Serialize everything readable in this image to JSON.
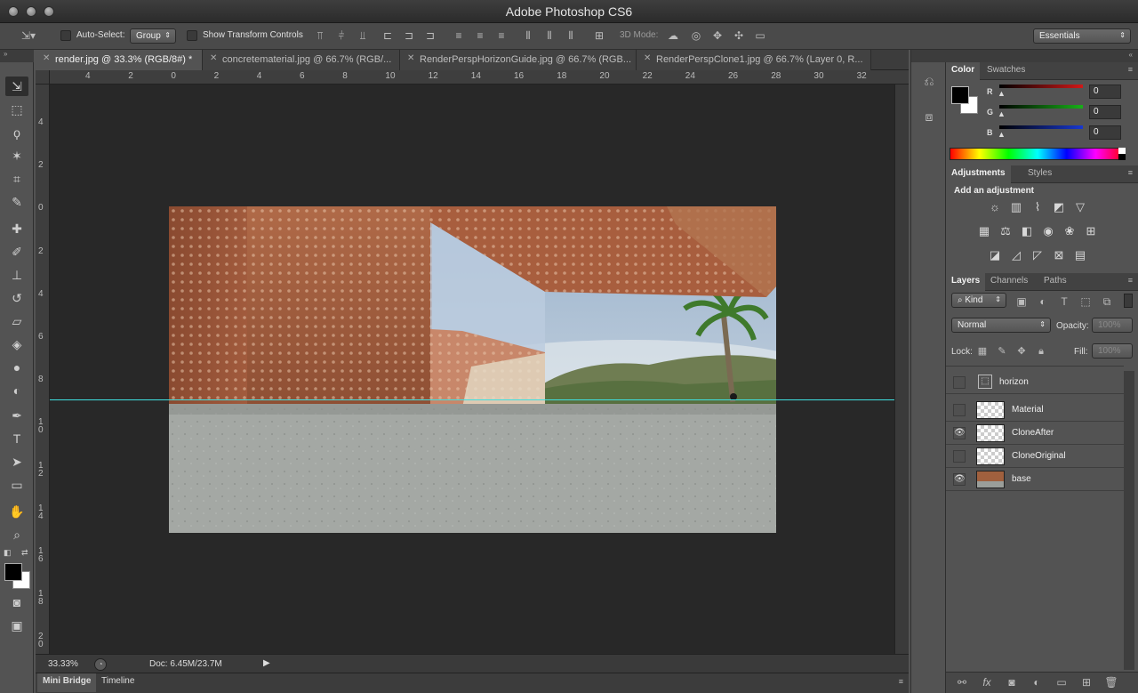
{
  "app": {
    "title": "Adobe Photoshop CS6"
  },
  "options": {
    "auto_select_label": "Auto-Select:",
    "auto_select_value": "Group",
    "transform_label": "Show Transform Controls",
    "mode_label": "3D Mode:",
    "workspace": "Essentials"
  },
  "tabs": [
    {
      "label": "render.jpg @ 33.3% (RGB/8#) *"
    },
    {
      "label": "concretematerial.jpg @ 66.7% (RGB/..."
    },
    {
      "label": "RenderPerspHorizonGuide.jpg @ 66.7% (RGB..."
    },
    {
      "label": "RenderPerspClone1.jpg @ 66.7% (Layer 0, R..."
    }
  ],
  "ruler": {
    "h_labels": [
      "4",
      "2",
      "0",
      "2",
      "4",
      "6",
      "8",
      "10",
      "12",
      "14",
      "16",
      "18",
      "20",
      "22",
      "24",
      "26",
      "28",
      "30",
      "32"
    ],
    "v_labels": [
      "4",
      "2",
      "0",
      "2",
      "4",
      "6",
      "8",
      "1 0",
      "1 2",
      "1 4",
      "1 6",
      "1 8",
      "2 0"
    ]
  },
  "status": {
    "zoom": "33.33%",
    "doc": "Doc: 6.45M/23.7M"
  },
  "bottom_tabs": [
    "Mini Bridge",
    "Timeline"
  ],
  "color_panel": {
    "tabs": [
      "Color",
      "Swatches"
    ],
    "channels": [
      {
        "label": "R",
        "value": "0",
        "color": "#d01818"
      },
      {
        "label": "G",
        "value": "0",
        "color": "#18b018"
      },
      {
        "label": "B",
        "value": "0",
        "color": "#1838d0"
      }
    ]
  },
  "adjustments_panel": {
    "tabs": [
      "Adjustments",
      "Styles"
    ],
    "heading": "Add an adjustment"
  },
  "layers_panel": {
    "tabs": [
      "Layers",
      "Channels",
      "Paths"
    ],
    "filter": "Kind",
    "blend_mode": "Normal",
    "opacity_label": "Opacity:",
    "opacity_value": "100%",
    "lock_label": "Lock:",
    "fill_label": "Fill:",
    "fill_value": "100%",
    "layers": [
      {
        "name": "horizon",
        "visible": false
      },
      {
        "name": "Material",
        "visible": false
      },
      {
        "name": "CloneAfter",
        "visible": true
      },
      {
        "name": "CloneOriginal",
        "visible": false
      },
      {
        "name": "base",
        "visible": true
      }
    ]
  },
  "colors": {
    "guide": "#3fe0e0",
    "foreground": "#000000",
    "background": "#ffffff"
  }
}
